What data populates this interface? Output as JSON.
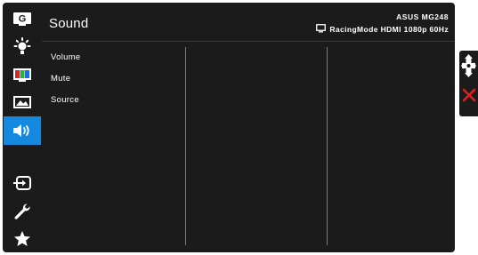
{
  "window": {
    "title": "Sound",
    "model": "ASUS MG248",
    "status": "RacingMode HDMI 1080p 60Hz"
  },
  "sidebar": {
    "items": [
      {
        "icon": "gameplus-icon",
        "glyph": "G",
        "active": false
      },
      {
        "icon": "brightness-icon",
        "active": false
      },
      {
        "icon": "color-icon",
        "active": false
      },
      {
        "icon": "image-icon",
        "active": false
      },
      {
        "icon": "speaker-icon",
        "active": true
      },
      {
        "icon": "input-select-icon",
        "active": false
      },
      {
        "icon": "wrench-icon",
        "active": false
      },
      {
        "icon": "star-icon",
        "active": false
      }
    ]
  },
  "menu": {
    "items": [
      "Volume",
      "Mute",
      "Source"
    ]
  },
  "nav": {
    "move_icon": "joystick-icon",
    "exit_icon": "close-icon",
    "exit_color": "#e0221e"
  },
  "colors": {
    "accent": "#1589e0",
    "background": "#1b1b1b"
  }
}
